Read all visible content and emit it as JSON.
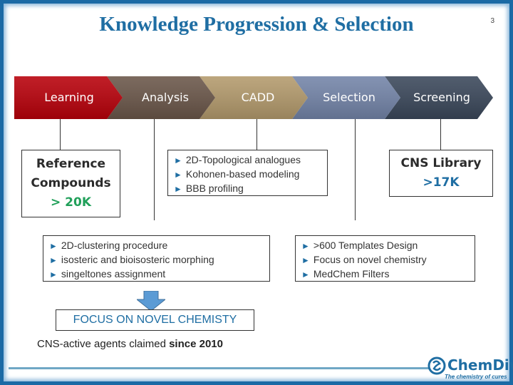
{
  "slide": {
    "title": "Knowledge Progression & Selection",
    "page_number": "3"
  },
  "process_steps": [
    {
      "label": "Learning",
      "color": "#b8000a"
    },
    {
      "label": "Analysis",
      "color": "#6a5649"
    },
    {
      "label": "CADD",
      "color": "#b39a6c"
    },
    {
      "label": "Selection",
      "color": "#7384a8"
    },
    {
      "label": "Screening",
      "color": "#3a475a"
    }
  ],
  "reference_box": {
    "line1": "Reference",
    "line2": "Compounds",
    "value": "> 20K",
    "value_color": "#21a05a"
  },
  "cadd_box": {
    "bullets": [
      "2D-Topological analogues",
      "Kohonen-based modeling",
      "BBB profiling"
    ]
  },
  "cns_box": {
    "line1": "CNS Library",
    "value": ">17K",
    "value_color": "#1f6ea3"
  },
  "analysis_box": {
    "bullets": [
      "2D-clustering procedure",
      "isosteric and bioisosteric morphing",
      "singeltones assignment"
    ]
  },
  "selection_box": {
    "bullets": [
      ">600 Templates Design",
      "Focus on novel chemistry",
      "MedChem Filters"
    ]
  },
  "focus_box": {
    "text": "FOCUS ON NOVEL CHEMISTY"
  },
  "claim": {
    "text": "CNS-active agents claimed ",
    "bold": "since 2010"
  },
  "logo": {
    "name": "ChemDiv",
    "tagline": "The chemistry of cures"
  },
  "bullet_glyph": "►"
}
